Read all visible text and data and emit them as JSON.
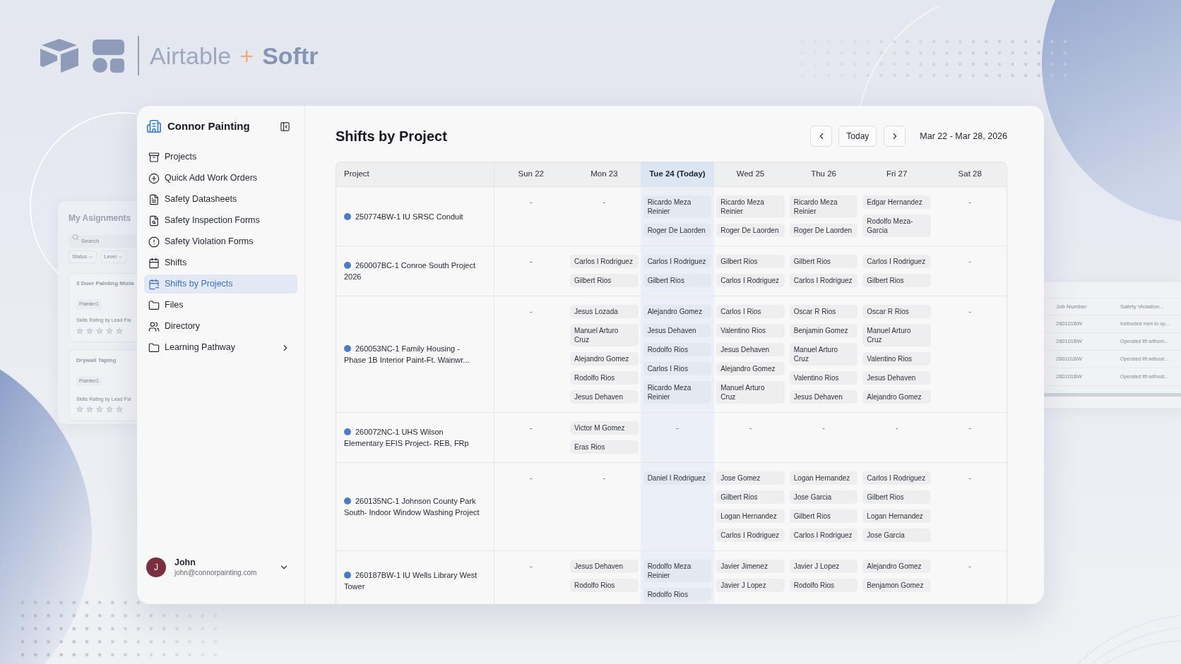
{
  "brand": {
    "name": "Airtable",
    "plus": "+",
    "partner": "Softr"
  },
  "background_panels": {
    "assignments": {
      "title": "My Asignments",
      "search": {
        "placeholder": "Search"
      },
      "filters": [
        "Status",
        "Level"
      ],
      "cards": [
        {
          "title": "3 Door Painting Mista",
          "role": "Painter1",
          "rating_label": "Skills Rating by Lead Pai",
          "stars": 0
        },
        {
          "title": "Drywall Taping",
          "role": "Painter1",
          "rating_label": "Skills Rating by Lead Pai",
          "stars": 0
        }
      ]
    },
    "violations_table": {
      "columns": [
        "Job Number",
        "Safety Violation..."
      ],
      "rows": [
        {
          "job_number": "260101BW",
          "violation": "Instructed men to op..."
        },
        {
          "job_number": "260101BW",
          "violation": "Operated lift withorn..."
        },
        {
          "job_number": "260101BW",
          "violation": "Operated lift without..."
        },
        {
          "job_number": "260101BW",
          "violation": "Operated lift without..."
        }
      ]
    }
  },
  "sidebar": {
    "title": "Connor Painting",
    "items": [
      {
        "label": "Projects",
        "selected": false,
        "kind": "link"
      },
      {
        "label": "Quick Add Work Orders",
        "selected": false,
        "kind": "link"
      },
      {
        "label": "Safety Datasheets",
        "selected": false,
        "kind": "link"
      },
      {
        "label": "Safety Inspection Forms",
        "selected": false,
        "kind": "link"
      },
      {
        "label": "Safety Violation Forms",
        "selected": false,
        "kind": "link"
      },
      {
        "label": "Shifts",
        "selected": false,
        "kind": "link"
      },
      {
        "label": "Shifts by Projects",
        "selected": true,
        "kind": "link"
      },
      {
        "label": "Files",
        "selected": false,
        "kind": "link"
      },
      {
        "label": "Directory",
        "selected": false,
        "kind": "link"
      },
      {
        "label": "Learning Pathway",
        "selected": false,
        "kind": "group"
      }
    ],
    "user": {
      "initial": "J",
      "name": "John",
      "email": "john@connorpainting.com"
    }
  },
  "main": {
    "title": "Shifts by Project",
    "today_button": "Today",
    "date_range": "Mar 22 - Mar 28, 2026",
    "table": {
      "columns": [
        {
          "label": "Project",
          "today": false
        },
        {
          "label": "Sun 22",
          "today": false
        },
        {
          "label": "Mon 23",
          "today": false
        },
        {
          "label": "Tue 24 (Today)",
          "today": true
        },
        {
          "label": "Wed 25",
          "today": false
        },
        {
          "label": "Thu 26",
          "today": false
        },
        {
          "label": "Fri 27",
          "today": false
        },
        {
          "label": "Sat 28",
          "today": false
        }
      ],
      "rows": [
        {
          "project": "250774BW-1 IU SRSC Conduit",
          "color": "#4a7cc8",
          "days": [
            {
              "kind": "empty",
              "text": "-"
            },
            {
              "kind": "empty",
              "text": "-"
            },
            {
              "kind": "shifts",
              "names": [
                "Ricardo Meza Reinier",
                "Roger De Laorden"
              ]
            },
            {
              "kind": "shifts",
              "names": [
                "Ricardo Meza Reinier",
                "Roger De Laorden"
              ]
            },
            {
              "kind": "shifts",
              "names": [
                "Ricardo Meza Reinier",
                "Roger De Laorden"
              ]
            },
            {
              "kind": "shifts",
              "names": [
                "Edgar Hernandez",
                "Rodolfo Meza-Garcia"
              ]
            },
            {
              "kind": "empty",
              "text": "-"
            }
          ]
        },
        {
          "project": "260007BC-1 Conroe South Project 2026",
          "color": "#4a7cc8",
          "days": [
            {
              "kind": "empty",
              "text": "-"
            },
            {
              "kind": "shifts",
              "names": [
                "Carlos I Rodriguez",
                "Gilbert Rios"
              ]
            },
            {
              "kind": "shifts",
              "names": [
                "Carlos I Rodriguez",
                "Gilbert Rios"
              ]
            },
            {
              "kind": "shifts",
              "names": [
                "Gilbert Rios",
                "Carlos I Rodriguez"
              ]
            },
            {
              "kind": "shifts",
              "names": [
                "Gilbert Rios",
                "Carlos I Rodriguez"
              ]
            },
            {
              "kind": "shifts",
              "names": [
                "Carlos I Rodriguez",
                "Gilbert Rios"
              ]
            },
            {
              "kind": "empty",
              "text": "-"
            }
          ]
        },
        {
          "project": "260053NC-1 Family Housing - Phase 1B Interior Paint-Ft. Wainwr...",
          "color": "#4a7cc8",
          "days": [
            {
              "kind": "empty",
              "text": "-"
            },
            {
              "kind": "shifts",
              "names": [
                "Jesus Lozada",
                "Manuel Arturo Cruz",
                "Alejandro Gomez",
                "Rodolfo Rios",
                "Jesus Dehaven"
              ]
            },
            {
              "kind": "shifts",
              "names": [
                "Alejandro Gomez",
                "Jesus Dehaven",
                "Rodolfo Rios",
                "Carlos I Rios",
                "Ricardo Meza Reinier"
              ]
            },
            {
              "kind": "shifts",
              "names": [
                "Carlos I Rios",
                "Valentino Rios",
                "Jesus Dehaven",
                "Alejandro Gomez",
                "Manuel Arturo Cruz"
              ]
            },
            {
              "kind": "shifts",
              "names": [
                "Oscar R Rios",
                "Benjamin Gomez",
                "Manuel Arturo Cruz",
                "Valentino Rios",
                "Jesus Dehaven"
              ]
            },
            {
              "kind": "shifts",
              "names": [
                "Oscar R Rios",
                "Manuel Arturo Cruz",
                "Valentino Rios",
                "Jesus Dehaven",
                "Alejandro Gomez"
              ]
            },
            {
              "kind": "empty",
              "text": "-"
            }
          ]
        },
        {
          "project": "260072NC-1 UHS Wilson Elementary EFIS Project- REB, FRp",
          "color": "#4a7cc8",
          "days": [
            {
              "kind": "empty",
              "text": "-"
            },
            {
              "kind": "shifts",
              "names": [
                "Victor M Gomez",
                "Eras Rios"
              ]
            },
            {
              "kind": "empty",
              "text": "-"
            },
            {
              "kind": "empty",
              "text": "-"
            },
            {
              "kind": "empty",
              "text": "-"
            },
            {
              "kind": "empty",
              "text": "-"
            },
            {
              "kind": "empty",
              "text": "-"
            }
          ]
        },
        {
          "project": "260135NC-1 Johnson County Park South- Indoor Window Washing Project",
          "color": "#4a7cc8",
          "days": [
            {
              "kind": "empty",
              "text": "-"
            },
            {
              "kind": "empty",
              "text": "-"
            },
            {
              "kind": "shifts",
              "names": [
                "Daniel I Rodriguez"
              ]
            },
            {
              "kind": "shifts",
              "names": [
                "Jose Gomez",
                "Gilbert Rios",
                "Logan Hernandez",
                "Carlos I Rodriguez"
              ]
            },
            {
              "kind": "shifts",
              "names": [
                "Logan Hernandez",
                "Jose Garcia",
                "Gilbert Rios",
                "Carlos I Rodriguez"
              ]
            },
            {
              "kind": "shifts",
              "names": [
                "Carlos I Rodriguez",
                "Gilbert Rios",
                "Logan Hernandez",
                "Jose Garcia"
              ]
            },
            {
              "kind": "empty",
              "text": "-"
            }
          ]
        },
        {
          "project": "260187BW-1 IU Wells Library West Tower",
          "color": "#4a7cc8",
          "days": [
            {
              "kind": "empty",
              "text": "-"
            },
            {
              "kind": "shifts",
              "names": [
                "Jesus Dehaven",
                "Rodolfo Rios"
              ]
            },
            {
              "kind": "shifts",
              "names": [
                "Rodolfo Meza Reinier",
                "Rodolfo Rios"
              ]
            },
            {
              "kind": "shifts",
              "names": [
                "Javier Jimenez",
                "Javier J Lopez"
              ]
            },
            {
              "kind": "shifts",
              "names": [
                "Javier J Lopez",
                "Rodolfo Rios"
              ]
            },
            {
              "kind": "shifts",
              "names": [
                "Alejandro Gomez",
                "Benjamon Gomez"
              ]
            },
            {
              "kind": "empty",
              "text": "-"
            }
          ]
        }
      ]
    }
  }
}
